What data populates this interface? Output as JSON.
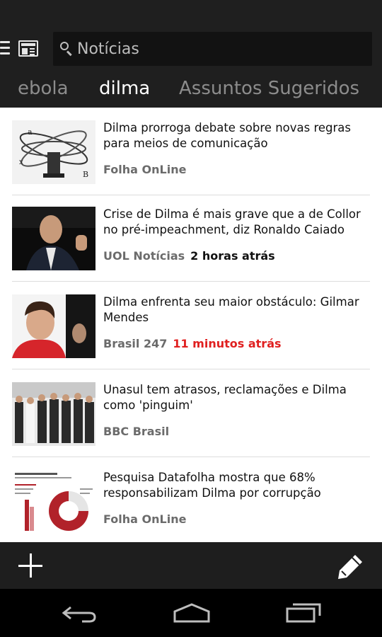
{
  "search": {
    "placeholder": "Notícias"
  },
  "tabs": [
    {
      "label": "ebola"
    },
    {
      "label": "dilma"
    },
    {
      "label": "Assuntos Sugeridos"
    }
  ],
  "articles": [
    {
      "headline": "Dilma prorroga debate sobre novas regras para meios de comunicação",
      "source": "Folha OnLine",
      "time": ""
    },
    {
      "headline": "Crise de Dilma é mais grave que a de Collor no pré-impeachment, diz Ronaldo Caiado",
      "source": "UOL Notícias",
      "time": "2 horas atrás"
    },
    {
      "headline": "Dilma enfrenta seu maior obstáculo: Gilmar Mendes",
      "source": "Brasil 247",
      "time": "11 minutos atrás"
    },
    {
      "headline": "Unasul tem atrasos, reclamações e Dilma como 'pinguim'",
      "source": "BBC Brasil",
      "time": ""
    },
    {
      "headline": "Pesquisa Datafolha mostra que 68% responsabilizam Dilma por corrupção",
      "source": "Folha OnLine",
      "time": ""
    }
  ],
  "colors": {
    "accent_time_recent": "#e02020",
    "bar_background": "#1e1e1e"
  },
  "icons": [
    "menu-icon",
    "newspaper-icon",
    "search-icon",
    "add-icon",
    "edit-pencil-icon",
    "back-icon",
    "home-icon",
    "recent-apps-icon"
  ]
}
